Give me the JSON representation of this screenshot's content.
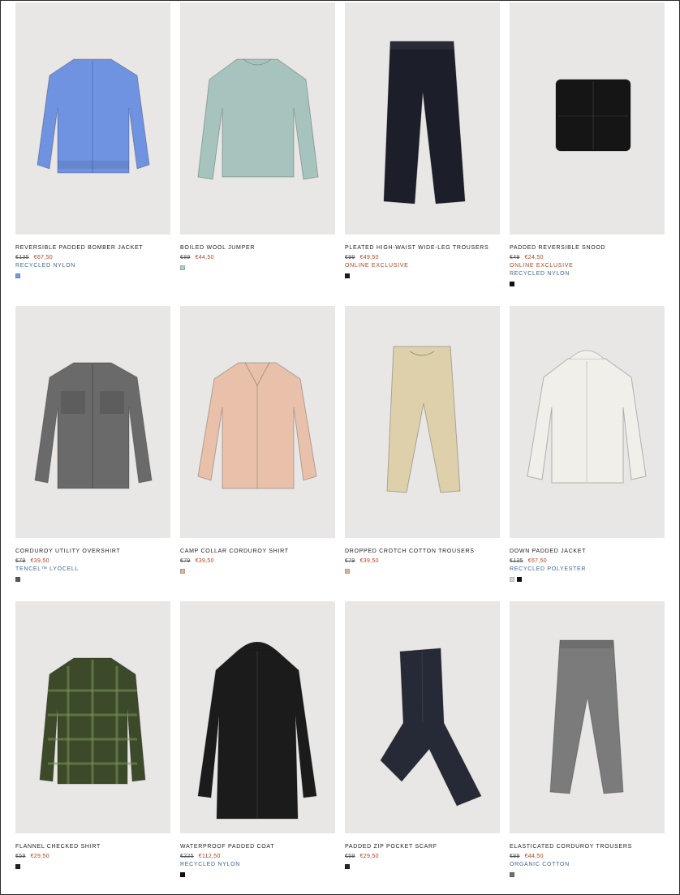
{
  "products": [
    {
      "name": "REVERSIBLE PADDED BOMBER JACKET",
      "old_price": "€135",
      "new_price": "€67,50",
      "exclusive": "",
      "material": "RECYCLED NYLON",
      "icon": "bomber-jacket",
      "garment_color": "#6f93e0",
      "swatches": [
        "#7a9bdc"
      ]
    },
    {
      "name": "BOILED WOOL JUMPER",
      "old_price": "€89",
      "new_price": "€44,50",
      "exclusive": "",
      "material": "",
      "icon": "wool-jumper",
      "garment_color": "#a6c4bd",
      "swatches": [
        "#b3ccc6"
      ]
    },
    {
      "name": "PLEATED HIGH-WAIST WIDE-LEG TROUSERS",
      "old_price": "€99",
      "new_price": "€49,50",
      "exclusive": "ONLINE EXCLUSIVE",
      "material": "",
      "icon": "wide-leg-trousers",
      "garment_color": "#1c1f2a",
      "swatches": [
        "#1d1d22"
      ]
    },
    {
      "name": "PADDED REVERSIBLE SNOOD",
      "old_price": "€49",
      "new_price": "€24,50",
      "exclusive": "ONLINE EXCLUSIVE",
      "material": "RECYCLED NYLON",
      "icon": "snood",
      "garment_color": "#151515",
      "swatches": [
        "#111111"
      ]
    },
    {
      "name": "CORDUROY UTILITY OVERSHIRT",
      "old_price": "€79",
      "new_price": "€39,50",
      "exclusive": "",
      "material": "TENCEL™ LYOCELL",
      "icon": "overshirt",
      "garment_color": "#6a6a6a",
      "swatches": [
        "#5a5a5a"
      ]
    },
    {
      "name": "CAMP COLLAR CORDUROY SHIRT",
      "old_price": "€79",
      "new_price": "€39,50",
      "exclusive": "",
      "material": "",
      "icon": "camp-collar-shirt",
      "garment_color": "#e9c1ab",
      "swatches": [
        "#d9b39e"
      ]
    },
    {
      "name": "DROPPED CROTCH COTTON TROUSERS",
      "old_price": "€79",
      "new_price": "€39,50",
      "exclusive": "",
      "material": "",
      "icon": "cotton-trousers",
      "garment_color": "#ddd0aa",
      "swatches": [
        "#cdb99a"
      ]
    },
    {
      "name": "DOWN PADDED JACKET",
      "old_price": "€135",
      "new_price": "€67,50",
      "exclusive": "",
      "material": "RECYCLED POLYESTER",
      "icon": "padded-jacket",
      "garment_color": "#f0efea",
      "swatches": [
        "#d8d5cd",
        "#111111"
      ]
    },
    {
      "name": "FLANNEL CHECKED SHIRT",
      "old_price": "€59",
      "new_price": "€29,50",
      "exclusive": "",
      "material": "",
      "icon": "checked-shirt",
      "garment_color": "#3d4a2a",
      "swatches": [
        "#1f2419"
      ]
    },
    {
      "name": "WATERPROOF PADDED COAT",
      "old_price": "€225",
      "new_price": "€112,50",
      "exclusive": "",
      "material": "RECYCLED NYLON",
      "icon": "padded-coat",
      "garment_color": "#1b1b1b",
      "swatches": [
        "#111111"
      ]
    },
    {
      "name": "PADDED ZIP POCKET SCARF",
      "old_price": "€59",
      "new_price": "€29,50",
      "exclusive": "",
      "material": "",
      "icon": "padded-scarf",
      "garment_color": "#262a36",
      "swatches": [
        "#22252e"
      ]
    },
    {
      "name": "ELASTICATED CORDUROY TROUSERS",
      "old_price": "€89",
      "new_price": "€44,50",
      "exclusive": "",
      "material": "ORGANIC COTTON",
      "icon": "corduroy-trousers",
      "garment_color": "#7b7b7b",
      "swatches": [
        "#707070"
      ]
    }
  ],
  "colors": {
    "sale": "#b5411f",
    "material": "#3e6699",
    "image_bg": "#e8e7e5"
  }
}
